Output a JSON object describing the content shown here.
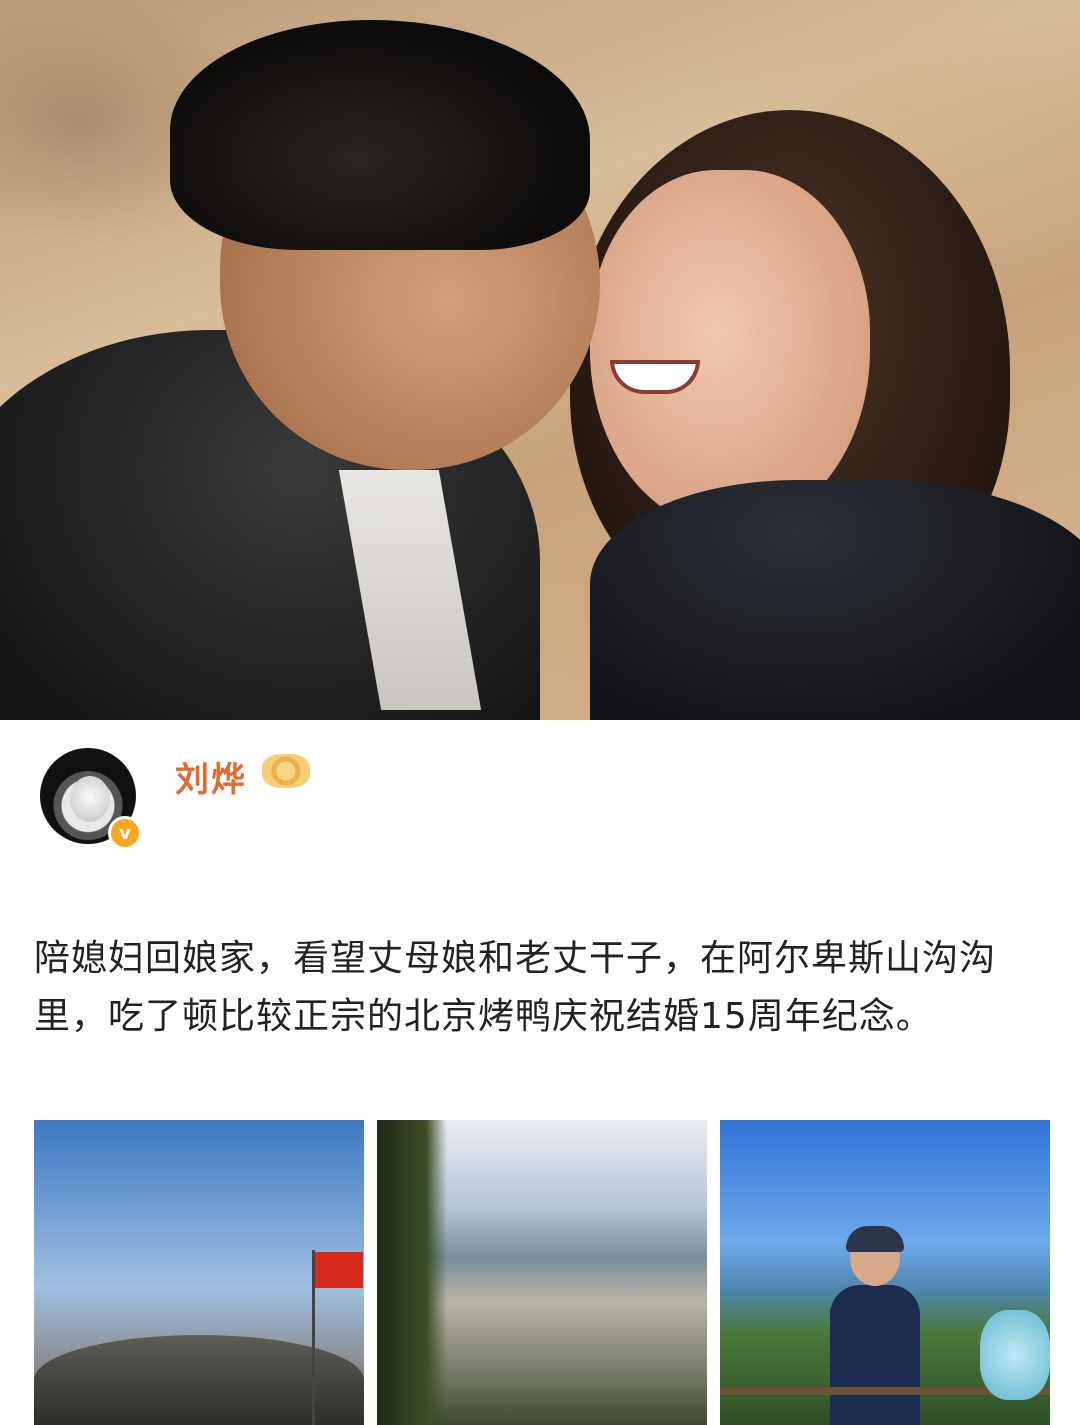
{
  "profile": {
    "username": "刘烨",
    "verified": true,
    "vip_badge_icon": "crown-badge-icon",
    "verified_icon": "verified-v-icon"
  },
  "post": {
    "text": "陪媳妇回娘家，看望丈母娘和老丈干子，在阿尔卑斯山沟沟里，吃了顿比较正宗的北京烤鸭庆祝结婚15周年纪念。"
  },
  "colors": {
    "username": "#e06b2f",
    "verified_badge": "#f5a623",
    "text": "#222222"
  },
  "photos": {
    "hero": "couple-kiss-photo",
    "thumbnails": [
      "flag-landscape-photo",
      "city-valley-photo",
      "man-on-mountain-photo"
    ]
  }
}
